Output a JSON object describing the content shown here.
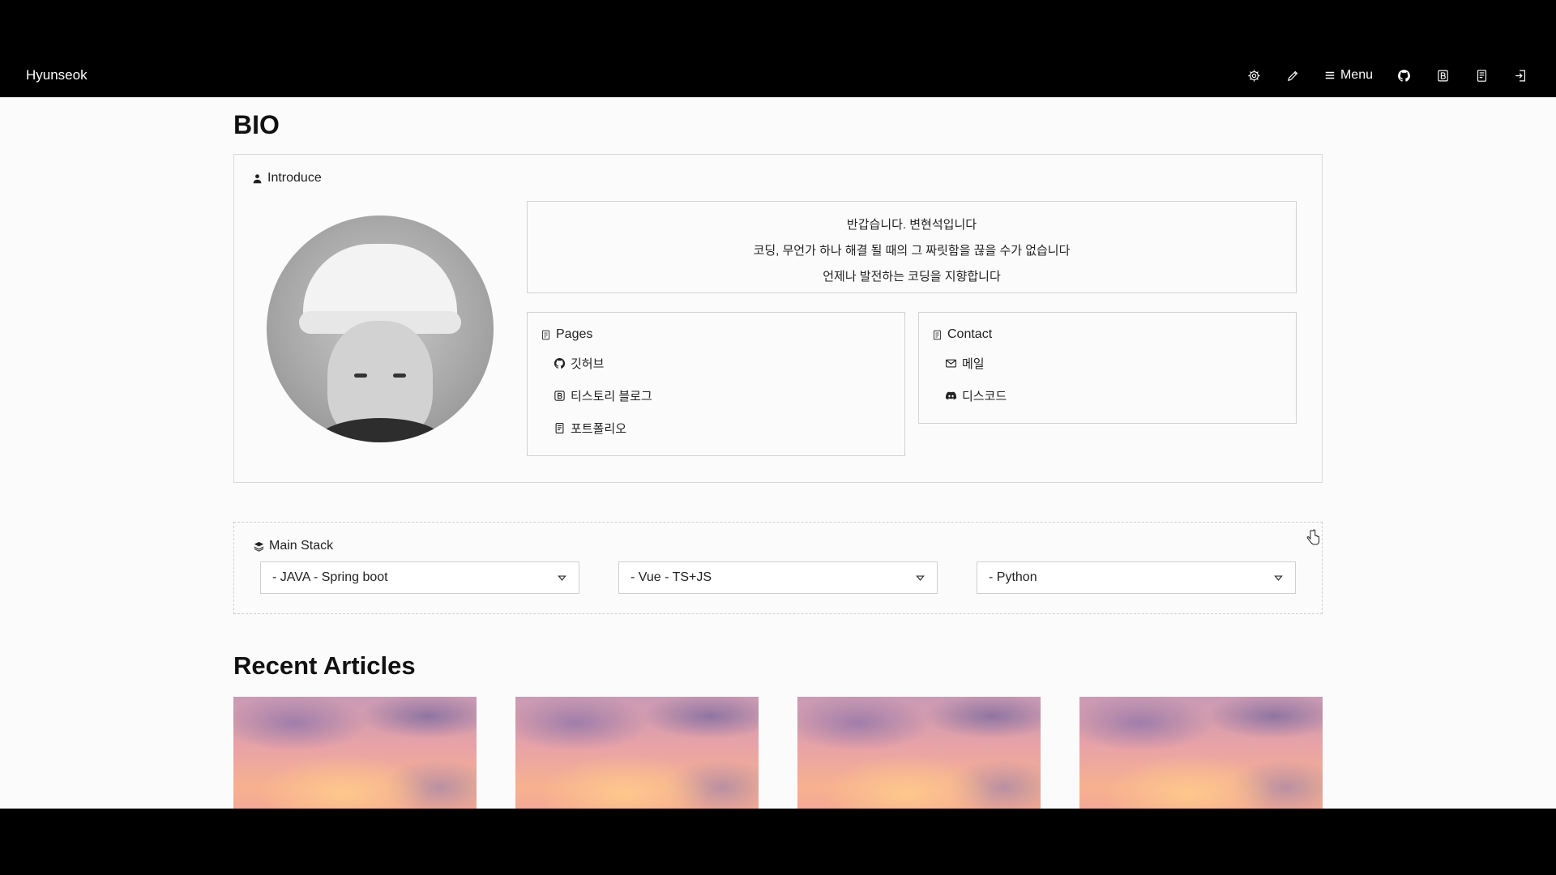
{
  "navbar": {
    "brand": "Hyunseok",
    "menu_label": "Menu",
    "icons": [
      "gear-icon",
      "pencil-icon",
      "menu-icon",
      "github-icon",
      "blog-b-icon",
      "document-icon",
      "login-icon"
    ]
  },
  "bio": {
    "title": "BIO",
    "introduce_label": "Introduce",
    "greeting_lines": [
      "반갑습니다. 변현석입니다",
      "코딩, 무언가 하나 해결 될 때의 그 짜릿함을 끊을 수가 없습니다",
      "언제나 발전하는 코딩을 지향합니다"
    ],
    "pages": {
      "label": "Pages",
      "items": [
        {
          "label": "깃허브",
          "icon": "github-icon"
        },
        {
          "label": "티스토리 블로그",
          "icon": "blog-b-icon"
        },
        {
          "label": "포트폴리오",
          "icon": "document-icon"
        }
      ]
    },
    "contact": {
      "label": "Contact",
      "items": [
        {
          "label": "메일",
          "icon": "mail-icon"
        },
        {
          "label": "디스코드",
          "icon": "discord-icon"
        }
      ]
    }
  },
  "main_stack": {
    "label": "Main Stack",
    "selects": [
      "- JAVA - Spring boot",
      "- Vue - TS+JS",
      "- Python"
    ]
  },
  "recent": {
    "title": "Recent Articles",
    "article_count_shown": 4
  },
  "colors": {
    "navbar_bg": "#000000",
    "page_bg": "#fbfbfb",
    "border": "#d2d2d2"
  }
}
